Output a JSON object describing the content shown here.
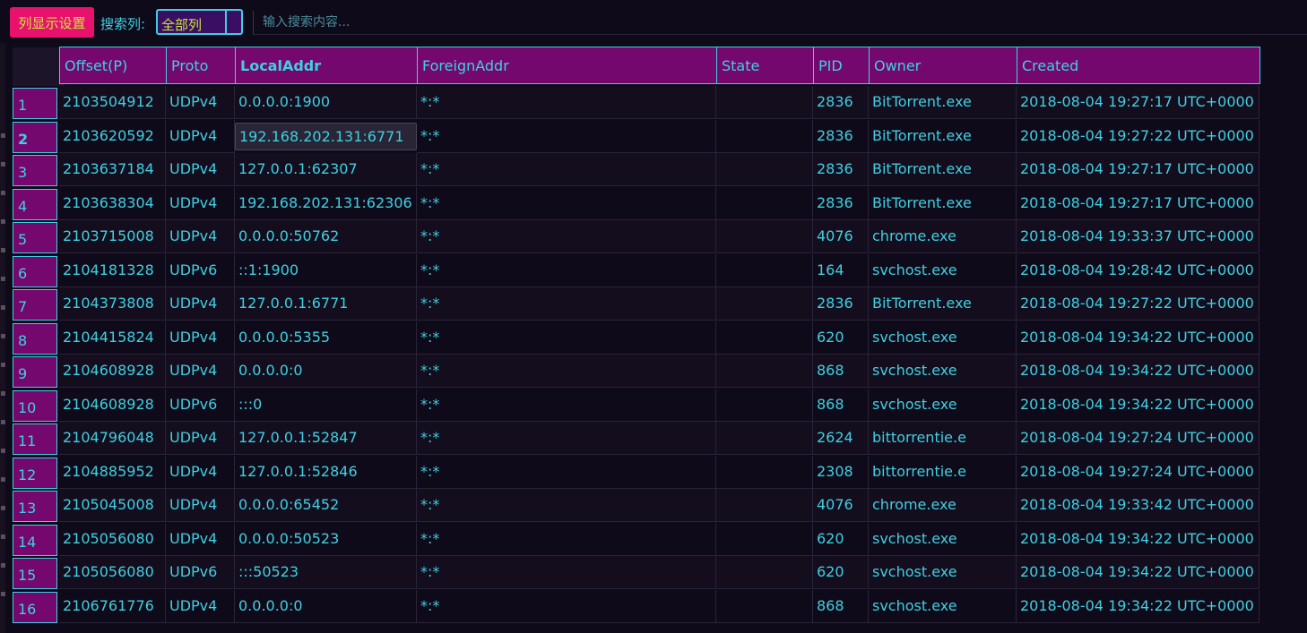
{
  "toolbar": {
    "column_settings_label": "列显示设置",
    "search_column_label": "搜索列:",
    "search_column_value": "全部列",
    "search_placeholder": "输入搜索内容..."
  },
  "colors": {
    "background": "#0f0a1a",
    "header_bg": "#75086f",
    "text_cyan": "#3fd0e0",
    "button_pink": "#e8126e",
    "accent_yellow": "#c9e63a"
  },
  "table": {
    "columns": [
      "Offset(P)",
      "Proto",
      "LocalAddr",
      "ForeignAddr",
      "State",
      "PID",
      "Owner",
      "Created"
    ],
    "sorted_column": "LocalAddr",
    "selected_row": 2,
    "rows": [
      {
        "num": "1",
        "offset": "2103504912",
        "proto": "UDPv4",
        "local": "0.0.0.0:1900",
        "foreign": "*:*",
        "state": "",
        "pid": "2836",
        "owner": "BitTorrent.exe",
        "created": "2018-08-04 19:27:17 UTC+0000"
      },
      {
        "num": "2",
        "offset": "2103620592",
        "proto": "UDPv4",
        "local": "192.168.202.131:6771",
        "foreign": "*:*",
        "state": "",
        "pid": "2836",
        "owner": "BitTorrent.exe",
        "created": "2018-08-04 19:27:22 UTC+0000"
      },
      {
        "num": "3",
        "offset": "2103637184",
        "proto": "UDPv4",
        "local": "127.0.0.1:62307",
        "foreign": "*:*",
        "state": "",
        "pid": "2836",
        "owner": "BitTorrent.exe",
        "created": "2018-08-04 19:27:17 UTC+0000"
      },
      {
        "num": "4",
        "offset": "2103638304",
        "proto": "UDPv4",
        "local": "192.168.202.131:62306",
        "foreign": "*:*",
        "state": "",
        "pid": "2836",
        "owner": "BitTorrent.exe",
        "created": "2018-08-04 19:27:17 UTC+0000"
      },
      {
        "num": "5",
        "offset": "2103715008",
        "proto": "UDPv4",
        "local": "0.0.0.0:50762",
        "foreign": "*:*",
        "state": "",
        "pid": "4076",
        "owner": "chrome.exe",
        "created": "2018-08-04 19:33:37 UTC+0000"
      },
      {
        "num": "6",
        "offset": "2104181328",
        "proto": "UDPv6",
        "local": "::1:1900",
        "foreign": "*:*",
        "state": "",
        "pid": "164",
        "owner": "svchost.exe",
        "created": "2018-08-04 19:28:42 UTC+0000"
      },
      {
        "num": "7",
        "offset": "2104373808",
        "proto": "UDPv4",
        "local": "127.0.0.1:6771",
        "foreign": "*:*",
        "state": "",
        "pid": "2836",
        "owner": "BitTorrent.exe",
        "created": "2018-08-04 19:27:22 UTC+0000"
      },
      {
        "num": "8",
        "offset": "2104415824",
        "proto": "UDPv4",
        "local": "0.0.0.0:5355",
        "foreign": "*:*",
        "state": "",
        "pid": "620",
        "owner": "svchost.exe",
        "created": "2018-08-04 19:34:22 UTC+0000"
      },
      {
        "num": "9",
        "offset": "2104608928",
        "proto": "UDPv4",
        "local": "0.0.0.0:0",
        "foreign": "*:*",
        "state": "",
        "pid": "868",
        "owner": "svchost.exe",
        "created": "2018-08-04 19:34:22 UTC+0000"
      },
      {
        "num": "10",
        "offset": "2104608928",
        "proto": "UDPv6",
        "local": ":::0",
        "foreign": "*:*",
        "state": "",
        "pid": "868",
        "owner": "svchost.exe",
        "created": "2018-08-04 19:34:22 UTC+0000"
      },
      {
        "num": "11",
        "offset": "2104796048",
        "proto": "UDPv4",
        "local": "127.0.0.1:52847",
        "foreign": "*:*",
        "state": "",
        "pid": "2624",
        "owner": "bittorrentie.e",
        "created": "2018-08-04 19:27:24 UTC+0000"
      },
      {
        "num": "12",
        "offset": "2104885952",
        "proto": "UDPv4",
        "local": "127.0.0.1:52846",
        "foreign": "*:*",
        "state": "",
        "pid": "2308",
        "owner": "bittorrentie.e",
        "created": "2018-08-04 19:27:24 UTC+0000"
      },
      {
        "num": "13",
        "offset": "2105045008",
        "proto": "UDPv4",
        "local": "0.0.0.0:65452",
        "foreign": "*:*",
        "state": "",
        "pid": "4076",
        "owner": "chrome.exe",
        "created": "2018-08-04 19:33:42 UTC+0000"
      },
      {
        "num": "14",
        "offset": "2105056080",
        "proto": "UDPv4",
        "local": "0.0.0.0:50523",
        "foreign": "*:*",
        "state": "",
        "pid": "620",
        "owner": "svchost.exe",
        "created": "2018-08-04 19:34:22 UTC+0000"
      },
      {
        "num": "15",
        "offset": "2105056080",
        "proto": "UDPv6",
        "local": ":::50523",
        "foreign": "*:*",
        "state": "",
        "pid": "620",
        "owner": "svchost.exe",
        "created": "2018-08-04 19:34:22 UTC+0000"
      },
      {
        "num": "16",
        "offset": "2106761776",
        "proto": "UDPv4",
        "local": "0.0.0.0:0",
        "foreign": "*:*",
        "state": "",
        "pid": "868",
        "owner": "svchost.exe",
        "created": "2018-08-04 19:34:22 UTC+0000"
      }
    ]
  }
}
